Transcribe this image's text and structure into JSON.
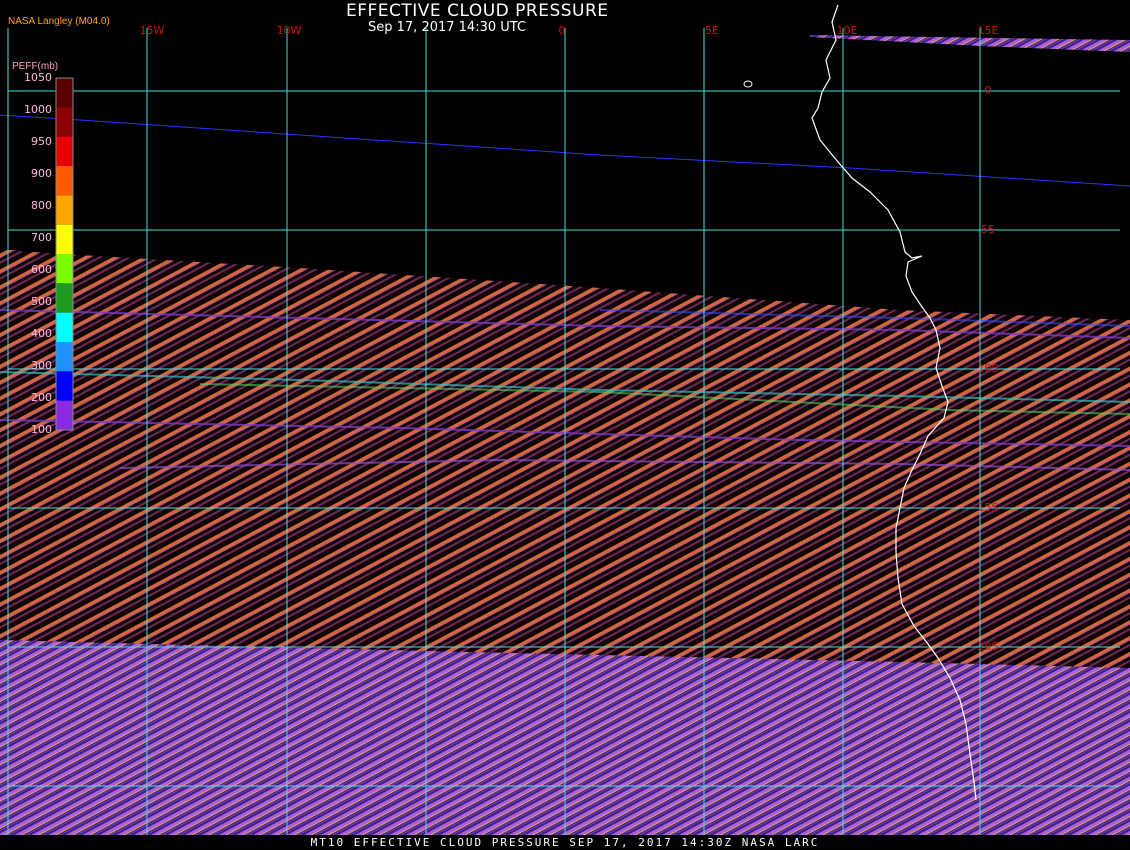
{
  "title": "EFFECTIVE CLOUD PRESSURE",
  "subtitle": "Sep 17, 2017 14:30 UTC",
  "provider": "NASA Langley (M04.0)",
  "footer": "MT10  EFFECTIVE CLOUD PRESSURE   SEP 17, 2017 14:30Z   NASA LARC",
  "legend": {
    "title": "PEFF(mb)",
    "ticks": [
      "1050",
      "1000",
      "950",
      "900",
      "800",
      "700",
      "600",
      "500",
      "400",
      "300",
      "200",
      "100"
    ],
    "colors": [
      "#5a0000",
      "#8b0000",
      "#e60000",
      "#ff5a00",
      "#ffa500",
      "#ffff00",
      "#7cfc00",
      "#1e9b1e",
      "#00ffff",
      "#1e90ff",
      "#0000ff",
      "#8a2be2"
    ]
  },
  "longitude_labels": [
    "15W",
    "10W",
    "0",
    "5E",
    "10E",
    "15E"
  ],
  "latitude_labels": [
    "0",
    "5S",
    "10S",
    "15S",
    "20S"
  ],
  "colors": {
    "background": "#000000",
    "grid": "#40e0e0",
    "grid_label": "#c81414",
    "coast": "#ffffff",
    "stripe_warm": "#d0683a",
    "stripe_purple": "#9050d0",
    "swath_edge": "#3030ff"
  }
}
